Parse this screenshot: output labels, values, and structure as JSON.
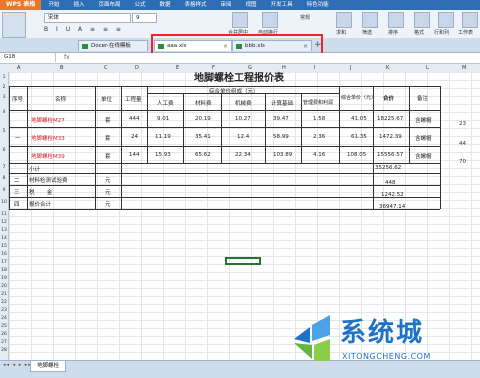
{
  "app": {
    "name": "WPS 表格"
  },
  "menu": [
    "开始",
    "插入",
    "页面布局",
    "公式",
    "数据",
    "表格样式",
    "审阅",
    "视图",
    "开发工具",
    "特色功能"
  ],
  "ribbon": {
    "font_name": "宋体",
    "font_size": "9",
    "labels": [
      "常规",
      "合并居中",
      "自动换行",
      "求和",
      "筛选",
      "排序",
      "格式",
      "行和列",
      "工作表"
    ]
  },
  "tabs": [
    {
      "label": "Docer-在线模板",
      "active": false
    },
    {
      "label": "aaa.xls",
      "active": true
    },
    {
      "label": "bbb.xls",
      "active": false
    }
  ],
  "formula_bar": {
    "cell_ref": "G18",
    "fx": "fx"
  },
  "columns": [
    "A",
    "B",
    "C",
    "D",
    "E",
    "F",
    "G",
    "H",
    "I",
    "J",
    "K",
    "L",
    "M"
  ],
  "rows": [
    "1",
    "2",
    "3",
    "4",
    "5",
    "6",
    "7",
    "8",
    "9",
    "10",
    "11",
    "12",
    "13",
    "14",
    "15",
    "16",
    "17",
    "18",
    "19",
    "20",
    "21",
    "22",
    "23",
    "24",
    "25",
    "26",
    "27",
    "28",
    "29",
    "30",
    "31",
    "32",
    "33"
  ],
  "sheet": {
    "title": "地脚螺栓工程报价表",
    "h_seq": "序号",
    "h_name": "名称",
    "h_unit": "单位",
    "h_qty": "工程量",
    "h_unit_price_group": "综合单价组成（元）",
    "h_labor": "人工费",
    "h_material": "材料费",
    "h_machine": "机械费",
    "h_base": "计算基础",
    "h_mgmt": "管理费和利润",
    "h_total_unit": "综合单价（元）",
    "h_total": "合价",
    "h_remark": "备注",
    "items": [
      {
        "seq": "",
        "name": "地脚螺栓M27",
        "unit": "套",
        "qty": "444",
        "labor": "9.01",
        "material": "20.19",
        "machine": "10.27",
        "base": "39.47",
        "mgmt": "1.58",
        "unit_total": "41.05",
        "total": "18225.67",
        "remark": "含螺帽"
      },
      {
        "seq": "一",
        "name": "地脚螺栓M33",
        "unit": "套",
        "qty": "24",
        "labor": "11.19",
        "material": "35.41",
        "machine": "12.4",
        "base": "58.99",
        "mgmt": "2.36",
        "unit_total": "61.35",
        "total": "1472.39",
        "remark": "含螺帽"
      },
      {
        "seq": "",
        "name": "地脚螺栓M39",
        "unit": "套",
        "qty": "144",
        "labor": "15.93",
        "material": "65.62",
        "machine": "22.34",
        "base": "103.89",
        "mgmt": "4.16",
        "unit_total": "108.05",
        "total": "15556.57",
        "remark": "含螺帽"
      }
    ],
    "subtotal_label": "小计",
    "subtotal_value": "35256.62",
    "extra_rows": [
      {
        "seq": "二",
        "name": "材料检测试验费",
        "unit": "元",
        "value": "448"
      },
      {
        "seq": "三",
        "name": "税       金",
        "unit": "元",
        "value": "1242.52"
      },
      {
        "seq": "四",
        "name": "报价合计",
        "unit": "元",
        "value": "36947.14"
      }
    ],
    "side_numbers": [
      "23",
      "44",
      "70"
    ]
  },
  "sheet_tab": "地脚螺栓",
  "watermark": {
    "text": "系统城",
    "sub": "XITONGCHENG.COM"
  }
}
